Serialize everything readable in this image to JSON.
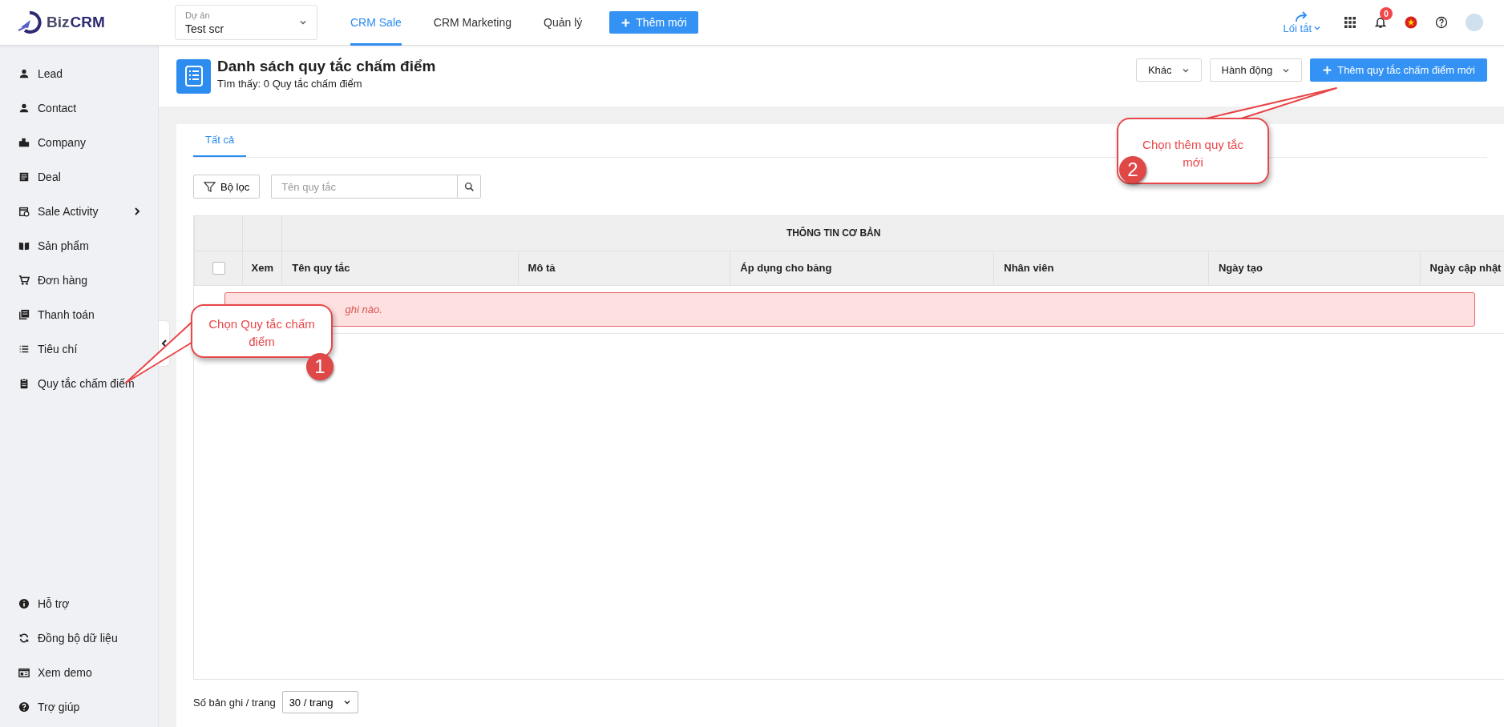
{
  "topbar": {
    "logo": [
      "Biz",
      "CRM"
    ],
    "project": {
      "label": "Dự án",
      "value": "Test scr"
    },
    "nav": [
      {
        "label": "CRM Sale",
        "selected": true
      },
      {
        "label": "CRM Marketing",
        "selected": false
      },
      {
        "label": "Quản lý",
        "selected": false
      }
    ],
    "add_button": "Thêm mới",
    "shortcut": "Lối tắt",
    "notification_count": "0"
  },
  "sidebar": {
    "items": [
      {
        "label": "Lead",
        "has_submenu": false
      },
      {
        "label": "Contact",
        "has_submenu": false
      },
      {
        "label": "Company",
        "has_submenu": false
      },
      {
        "label": "Deal",
        "has_submenu": false
      },
      {
        "label": "Sale Activity",
        "has_submenu": true
      },
      {
        "label": "Sản phẩm",
        "has_submenu": false
      },
      {
        "label": "Đơn hàng",
        "has_submenu": false
      },
      {
        "label": "Thanh toán",
        "has_submenu": false
      },
      {
        "label": "Tiêu chí",
        "has_submenu": false
      },
      {
        "label": "Quy tắc chấm điểm",
        "has_submenu": false
      }
    ],
    "bottom_items": [
      {
        "label": "Hỗ trợ"
      },
      {
        "label": "Đồng bộ dữ liệu"
      },
      {
        "label": "Xem demo"
      },
      {
        "label": "Trợ giúp"
      }
    ]
  },
  "page": {
    "title": "Danh sách quy tắc chấm điểm",
    "subtitle": "Tìm thấy: 0 Quy tắc chấm điểm",
    "buttons": [
      {
        "label": "Khác",
        "kind": "dropdown"
      },
      {
        "label": "Hành động",
        "kind": "dropdown"
      },
      {
        "label": "Thêm quy tắc chấm điểm mới",
        "kind": "primary"
      }
    ]
  },
  "tabs": [
    {
      "label": "Tất cả",
      "selected": true
    }
  ],
  "filter": {
    "button": "Bộ lọc",
    "placeholder": "Tên quy tắc"
  },
  "table": {
    "group_header": "THÔNG TIN CƠ BẢN",
    "select_all_checked": false,
    "columns": [
      "Xem",
      "Tên quy tắc",
      "Mô tả",
      "Áp dụng cho bảng",
      "Nhân viên",
      "Ngày tạo",
      "Ngày cập nhật"
    ],
    "empty_message": "ghi nào."
  },
  "footer": {
    "label": "Số bản ghi / trang",
    "page_size": "30 / trang"
  },
  "annotations": [
    {
      "text": "Chọn Quy tắc chấm điểm",
      "number": "1"
    },
    {
      "text": "Chọn thêm quy tắc mới",
      "number": "2"
    }
  ]
}
